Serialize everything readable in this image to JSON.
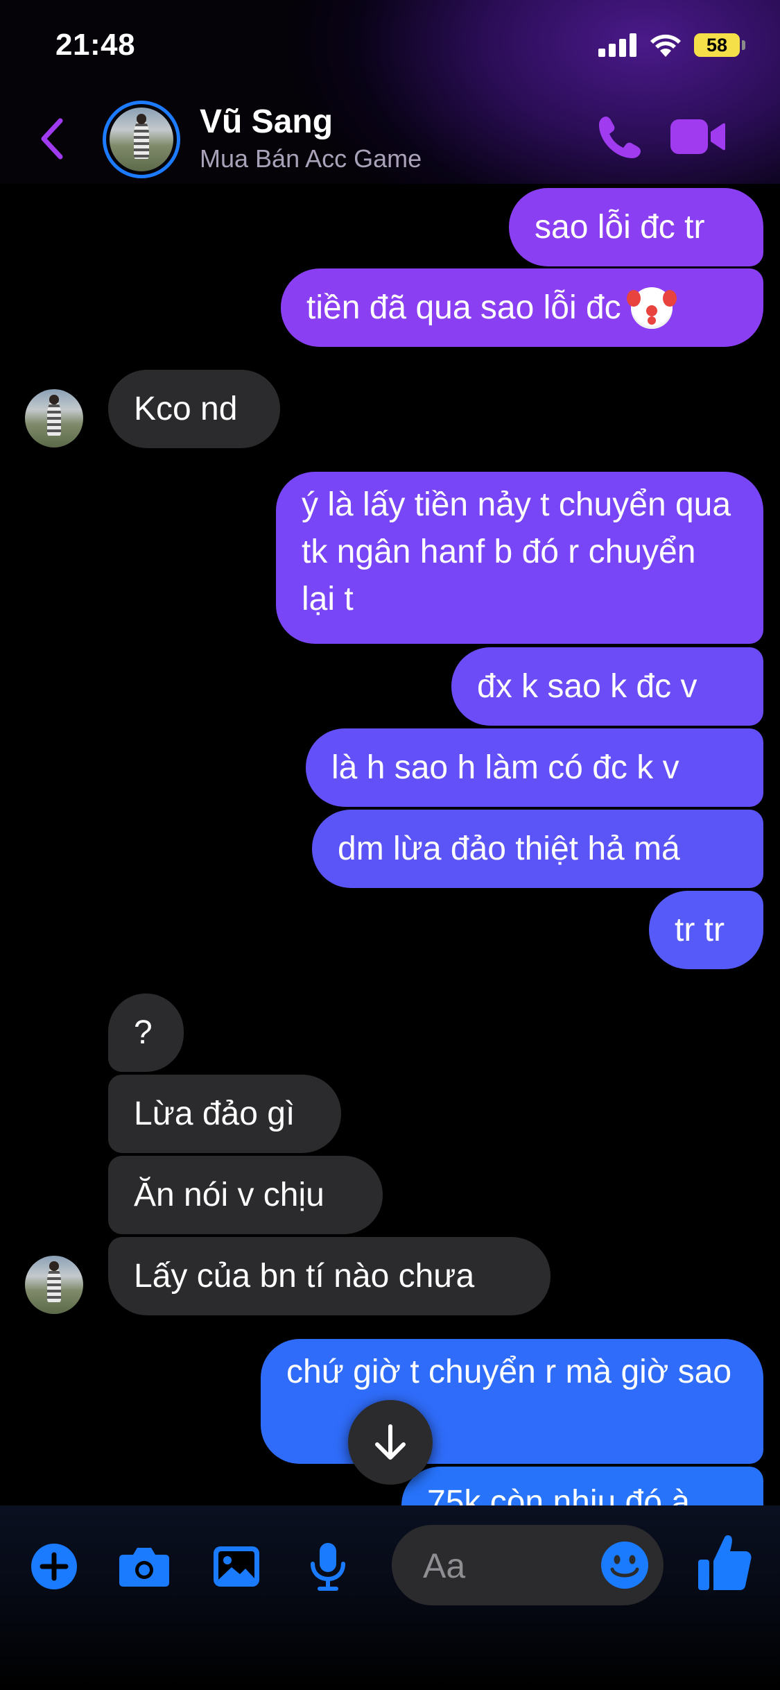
{
  "status_bar": {
    "time": "21:48",
    "battery_percent": "58",
    "signal_bars": 4,
    "wifi": true
  },
  "header": {
    "contact_name": "Vũ Sang",
    "subtitle": "Mua Bán Acc Game",
    "accent_color": "#a03bf0",
    "icons": [
      "back-chevron-icon",
      "phone-icon",
      "video-camera-icon"
    ]
  },
  "messages": [
    {
      "from": "me",
      "text": "sao lỗi đc tr",
      "color": "#8b3ff2"
    },
    {
      "from": "me",
      "text": "tiền đã qua sao lỗi đc",
      "emoji": "clown-face-emoji",
      "color": "#8b3ff2"
    },
    {
      "from": "them",
      "text": "Kco nd"
    },
    {
      "from": "me",
      "text": "ý là lấy tiền nảy t chuyển qua tk ngân hanf b đó r chuyển lại t",
      "color": "#7846f6"
    },
    {
      "from": "me",
      "text": "đx k sao k đc v",
      "color": "#6c4cf7"
    },
    {
      "from": "me",
      "text": "là h sao h làm có đc k v",
      "color": "#6450f8"
    },
    {
      "from": "me",
      "text": "dm lừa đảo thiệt hả má",
      "color": "#5b55f8"
    },
    {
      "from": "me",
      "text": "tr tr",
      "color": "#555af8"
    },
    {
      "from": "them",
      "text": "?"
    },
    {
      "from": "them",
      "text": "Lừa đảo gì"
    },
    {
      "from": "them",
      "text": "Ăn nói v chịu"
    },
    {
      "from": "them",
      "text": "Lấy của bn tí nào chưa"
    },
    {
      "from": "me",
      "text": "chứ giờ t chuyển r mà giờ sao",
      "color": "#2f6cf9"
    },
    {
      "from": "me",
      "text": "75k còn nhiu đó à",
      "color": "#2773fa"
    }
  ],
  "composer": {
    "placeholder": "Aa",
    "tools": [
      "plus-icon",
      "camera-icon",
      "photo-icon",
      "microphone-icon"
    ],
    "accent_color": "#1a7bff"
  }
}
